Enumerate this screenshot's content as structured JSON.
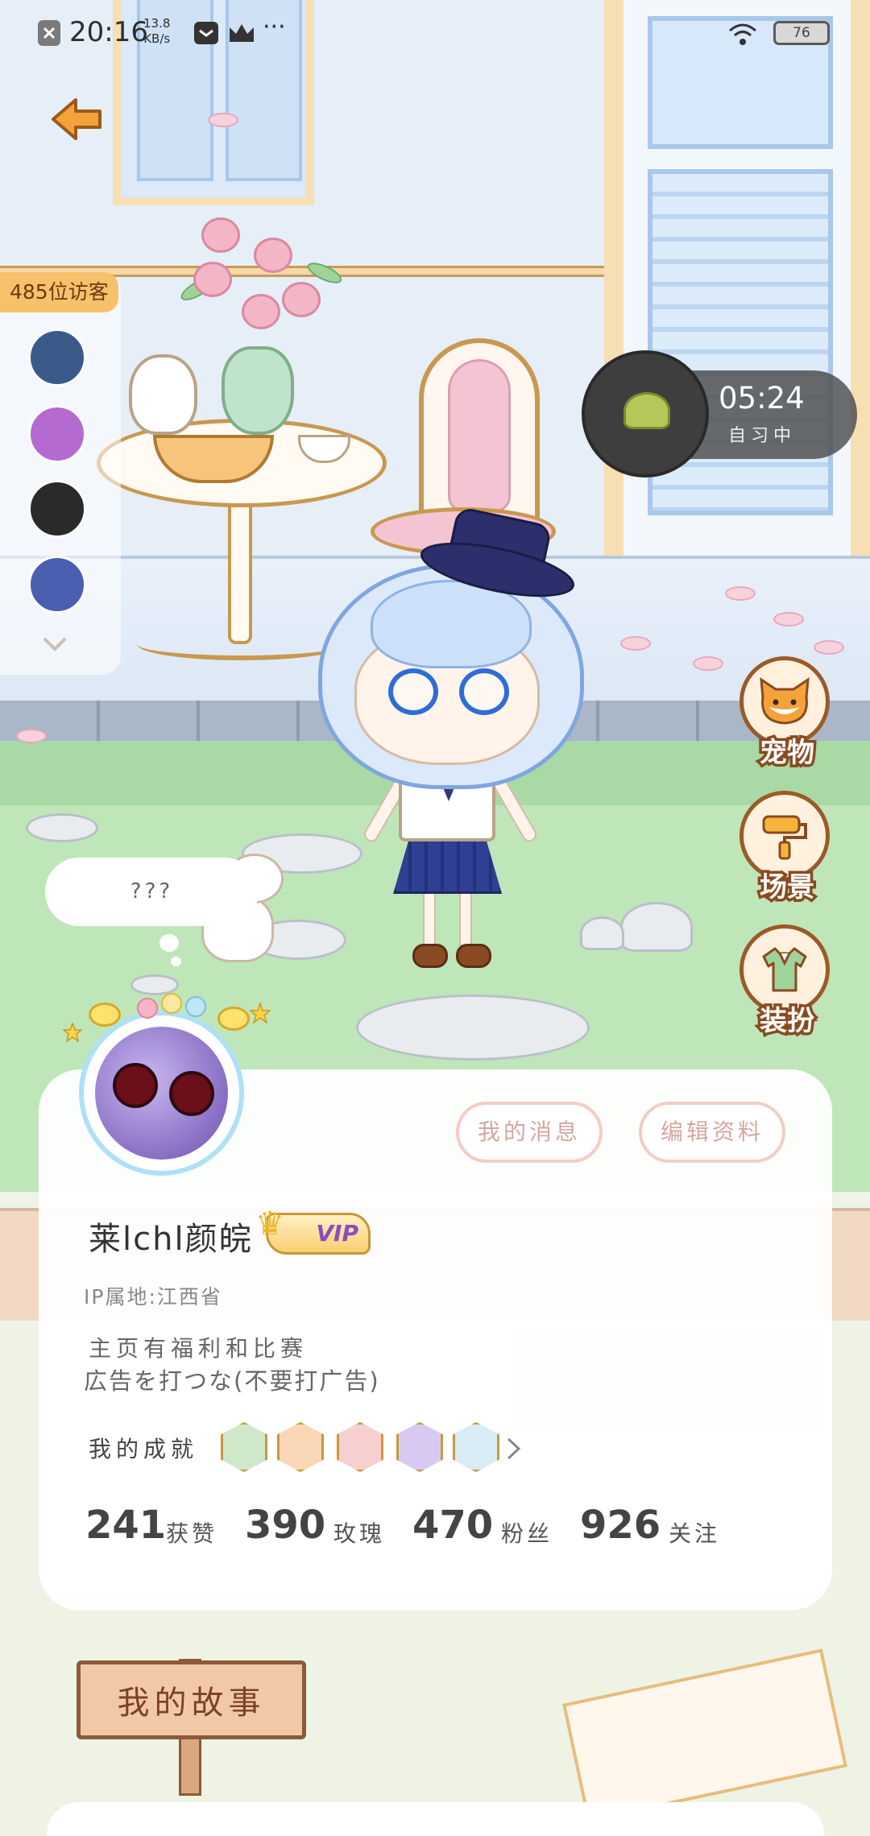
{
  "status_bar": {
    "time": "20:16",
    "net_speed_value": "13.8",
    "net_speed_unit": "KB/s",
    "more": "···",
    "battery": "76"
  },
  "visitors": {
    "title": "485位访客",
    "avatar_colors": [
      "#3a5a8a",
      "#b46ad0",
      "#2a2a2a",
      "#4a5fb0"
    ]
  },
  "timer": {
    "time": "05:24",
    "status": "自习中"
  },
  "side_buttons": [
    {
      "label": "宠物",
      "icon": "cat-icon"
    },
    {
      "label": "场景",
      "icon": "paint-roller-icon"
    },
    {
      "label": "装扮",
      "icon": "shirt-icon"
    }
  ],
  "speech_bubble": "???",
  "profile": {
    "messages_button": "我的消息",
    "edit_button": "编辑资料",
    "username": "莱lchl颜皖",
    "vip_label": "VIP",
    "ip_location": "IP属地:江西省",
    "bio_line1": "主页有福利和比赛",
    "bio_line2": "広告を打つな(不要打广告)",
    "achievements_label": "我的成就",
    "achievement_badge_colors": [
      "#cfe8c9",
      "#f9d6b6",
      "#f8cfcf",
      "#d9c9f2",
      "#d8ecf5"
    ],
    "stats": [
      {
        "value": "241",
        "label": "获赞"
      },
      {
        "value": "390",
        "label": "玫瑰"
      },
      {
        "value": "470",
        "label": "粉丝"
      },
      {
        "value": "926",
        "label": "关注"
      }
    ]
  },
  "story_sign": "我的故事",
  "colors": {
    "accent_brown": "#8a4a20",
    "card_bg": "#ffffff",
    "outline_button": "#f4ccc6"
  }
}
